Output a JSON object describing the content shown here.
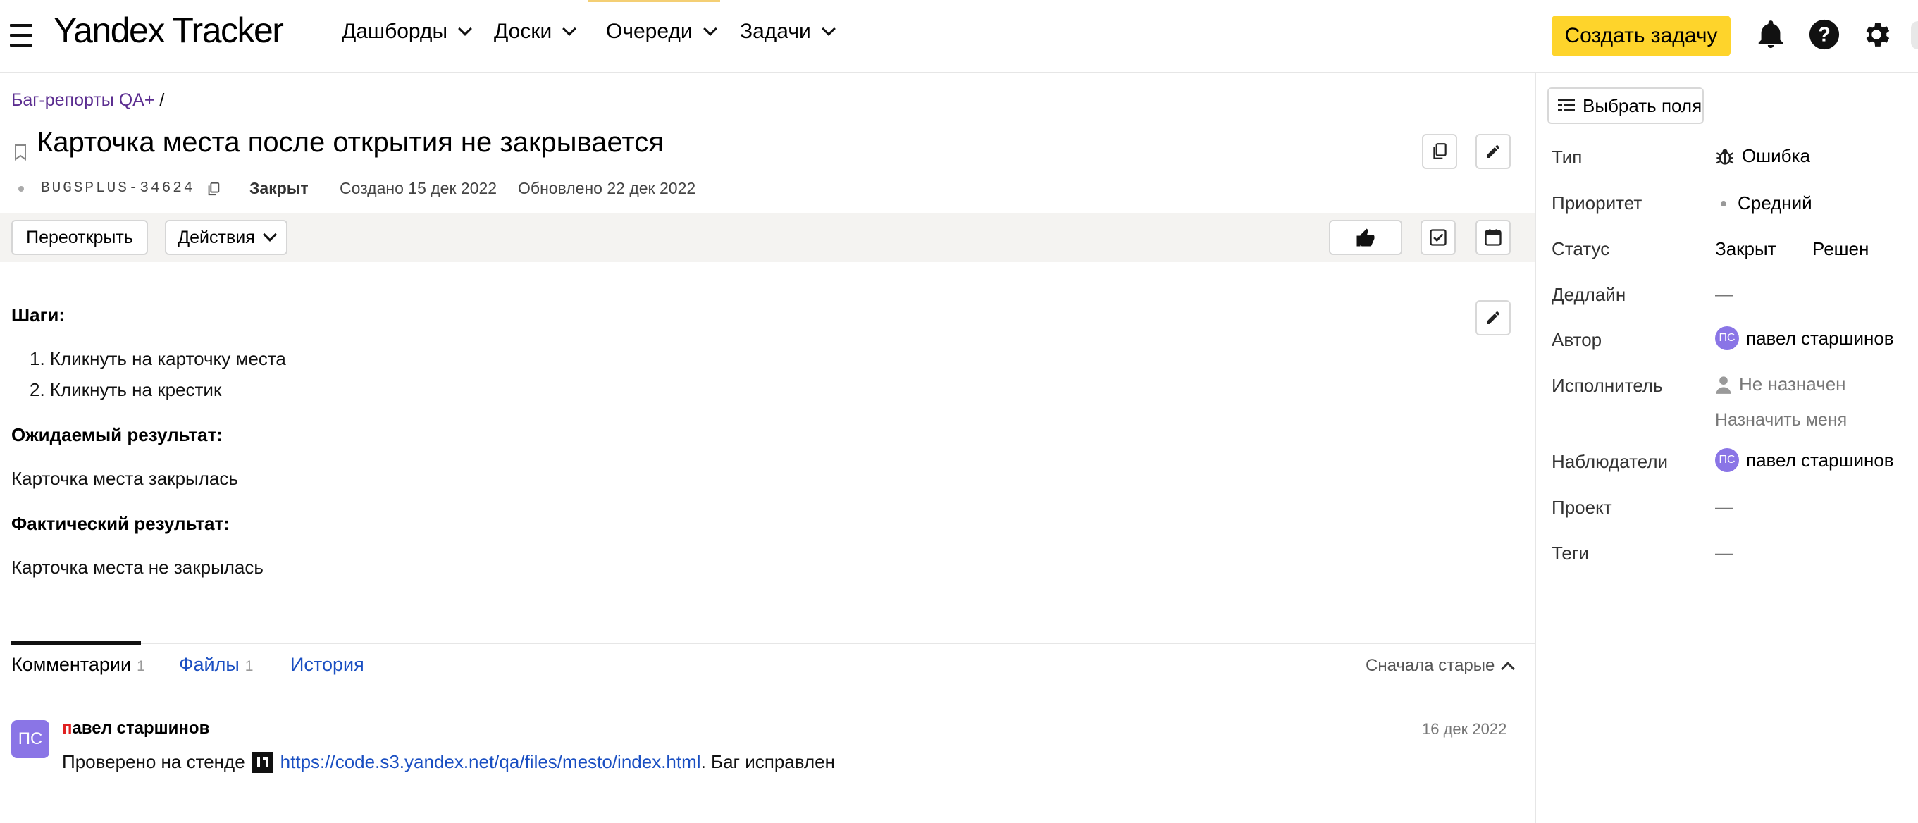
{
  "header": {
    "logo": "Yandex Tracker",
    "nav": [
      {
        "label": "Дашборды"
      },
      {
        "label": "Доски"
      },
      {
        "label": "Очереди"
      },
      {
        "label": "Задачи"
      }
    ],
    "create_button": "Создать задачу",
    "accent_color": "#fed42b"
  },
  "breadcrumb": {
    "queue": "Баг-репорты QA+",
    "separator": "/"
  },
  "issue": {
    "title": "Карточка места после открытия не закрывается",
    "key": "BUGSPLUS-34624",
    "status": "Закрыт",
    "created": "Создано 15 дек 2022",
    "updated": "Обновлено 22 дек 2022"
  },
  "toolbar": {
    "reopen": "Переоткрыть",
    "actions": "Действия"
  },
  "description": {
    "steps_heading": "Шаги:",
    "steps": [
      "Кликнуть на карточку места",
      "Кликнуть на крестик"
    ],
    "expected_heading": "Ожидаемый результат:",
    "expected": "Карточка места закрылась",
    "actual_heading": "Фактический результат:",
    "actual": "Карточка места не закрылась"
  },
  "tabs": [
    {
      "label": "Комментарии",
      "count": "1"
    },
    {
      "label": "Файлы",
      "count": "1"
    },
    {
      "label": "История",
      "count": ""
    }
  ],
  "sort_label": "Сначала старые",
  "comment": {
    "avatar": "ПС",
    "author_first": "п",
    "author_rest": "авел старшинов",
    "date": "16 дек 2022",
    "text_before": "Проверено на стенде",
    "link": "https://code.s3.yandex.net/qa/files/mesto/index.html",
    "text_after": ". Баг исправлен"
  },
  "sidebar": {
    "select_fields": "Выбрать поля",
    "fields": {
      "type_label": "Тип",
      "type_value": "Ошибка",
      "priority_label": "Приоритет",
      "priority_value": "Средний",
      "status_label": "Статус",
      "status_value": "Закрыт",
      "resolution_value": "Решен",
      "deadline_label": "Дедлайн",
      "deadline_value": "—",
      "author_label": "Автор",
      "author_avatar": "ПС",
      "author_value": "павел старшинов",
      "assignee_label": "Исполнитель",
      "assignee_value": "Не назначен",
      "assign_me": "Назначить меня",
      "followers_label": "Наблюдатели",
      "followers_avatar": "ПС",
      "followers_value": "павел старшинов",
      "project_label": "Проект",
      "project_value": "—",
      "tags_label": "Теги",
      "tags_value": "—"
    }
  }
}
